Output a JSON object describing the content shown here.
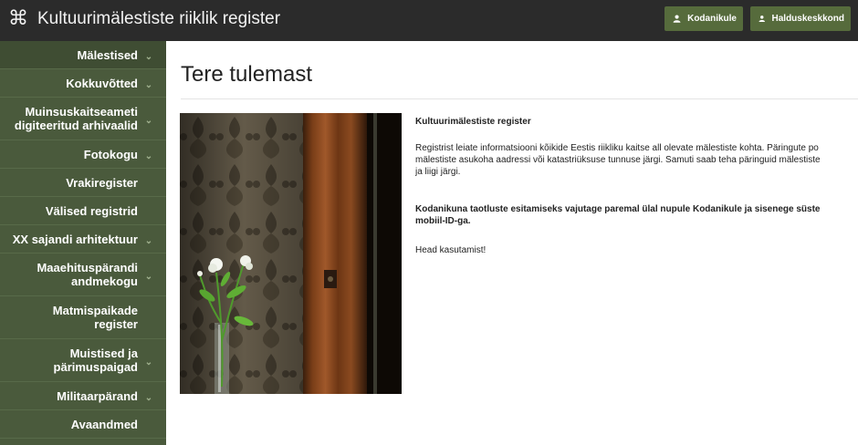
{
  "header": {
    "app_icon": "command-icon",
    "app_title": "Kultuurimälestiste riiklik register",
    "buttons": [
      {
        "label": "Kodanikule",
        "icon": "user-icon"
      },
      {
        "label": "Halduskeskkond",
        "icon": "user-icon"
      }
    ]
  },
  "sidebar": {
    "items": [
      {
        "label": "Mälestised",
        "has_submenu": true
      },
      {
        "label": "Kokkuvõtted",
        "has_submenu": true
      },
      {
        "label": "Muinsuskaitseameti digiteeritud arhivaalid",
        "line1": "Muinsuskaitseameti",
        "line2": "digiteeritud arhivaalid",
        "has_submenu": true
      },
      {
        "label": "Fotokogu",
        "has_submenu": true
      },
      {
        "label": "Vrakiregister",
        "has_submenu": false
      },
      {
        "label": "Välised registrid",
        "has_submenu": false
      },
      {
        "label": "XX sajandi arhitektuur",
        "has_submenu": true
      },
      {
        "label": "Maaehituspärandi andmekogu",
        "line1": "Maaehituspärandi",
        "line2": "andmekogu",
        "has_submenu": true
      },
      {
        "label": "Matmispaikade register",
        "line1": "Matmispaikade",
        "line2": "register",
        "has_submenu": false
      },
      {
        "label": "Muistised ja pärimuspaigad",
        "line1": "Muistised ja",
        "line2": "pärimuspaigad",
        "has_submenu": true
      },
      {
        "label": "Militaarpärand",
        "has_submenu": true
      },
      {
        "label": "Avaandmed",
        "has_submenu": false
      }
    ]
  },
  "main": {
    "title": "Tere tulemast",
    "heading": "Kultuurimälestiste register",
    "para1_line1": "Registrist leiate informatsiooni kõikide Eestis riikliku kaitse all olevate mälestiste kohta.  Päringute po",
    "para1_line2": "mälestiste asukoha aadressi või katastriüksuse tunnuse järgi. Samuti saab teha päringuid mälestiste",
    "para1_line3": "ja liigi järgi.",
    "para2_line1": "Kodanikuna taotluste esitamiseks vajutage paremal ülal nupule Kodanikule ja sisenege süste",
    "para2_line2": "mobiil-ID-ga.",
    "closing": "Head kasutamist!"
  }
}
